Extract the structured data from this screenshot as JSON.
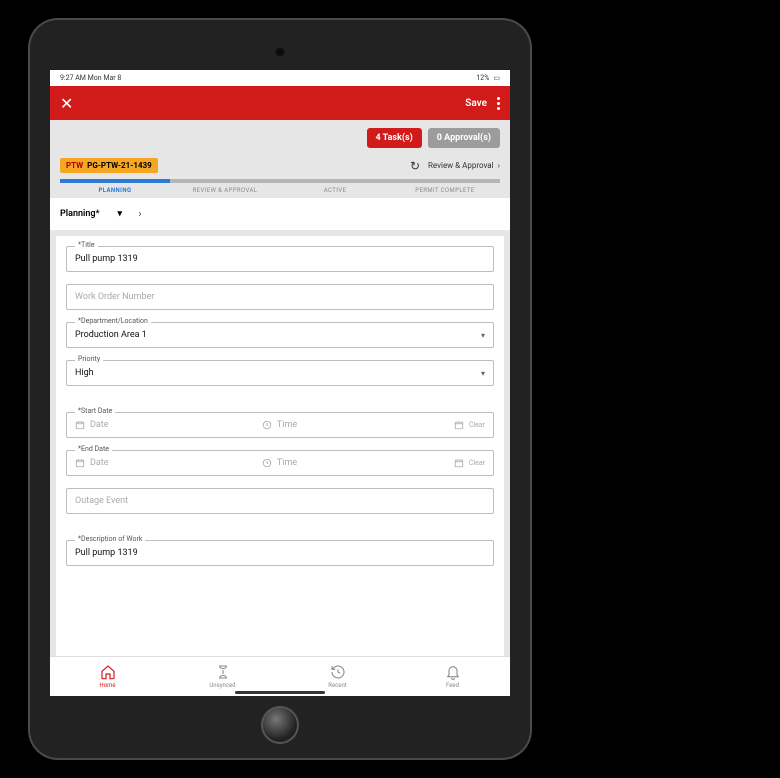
{
  "status": {
    "time": "9:27 AM  Mon Mar 8",
    "battery": "12%"
  },
  "header": {
    "save": "Save"
  },
  "pills": {
    "tasks": "4 Task(s)",
    "approvals": "0 Approval(s)"
  },
  "permit": {
    "prefix": "PTW",
    "id": "PG-PTW-21-1439",
    "review_label": "Review & Approval"
  },
  "steps": [
    "PLANNING",
    "REVIEW\n& APPROVAL",
    "ACTIVE",
    "PERMIT\nCOMPLETE"
  ],
  "section": {
    "selected": "Planning*"
  },
  "form": {
    "title": {
      "label": "*Title",
      "value": "Pull pump 1319"
    },
    "work_order": {
      "placeholder": "Work Order Number"
    },
    "department": {
      "label": "*Department/Location",
      "value": "Production Area 1"
    },
    "priority": {
      "label": "Priority",
      "value": "High"
    },
    "start": {
      "label": "*Start Date",
      "date_ph": "Date",
      "time_ph": "Time",
      "clear": "Clear"
    },
    "end": {
      "label": "*End Date",
      "date_ph": "Date",
      "time_ph": "Time",
      "clear": "Clear"
    },
    "outage": {
      "placeholder": "Outage Event"
    },
    "description": {
      "label": "*Description of Work",
      "value": "Pull pump 1319"
    }
  },
  "nav": [
    "Home",
    "Unsynced",
    "Recent",
    "Feed"
  ]
}
